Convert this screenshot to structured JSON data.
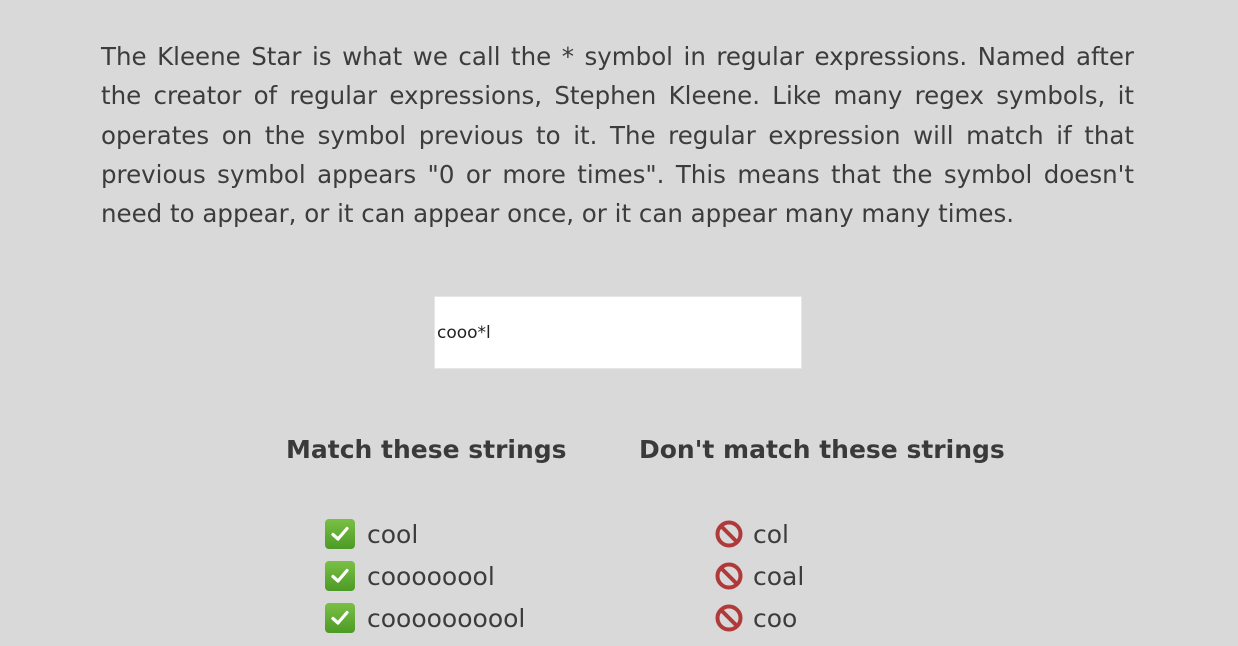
{
  "lesson": {
    "paragraph": "The Kleene Star is what we call the * symbol in regular expressions. Named after the creator of regular expressions, Stephen Kleene. Like many regex symbols, it operates on the symbol previous to it. The regular expression will match if that previous symbol appears \"0 or more times\". This means that the symbol doesn't need to appear, or it can appear once, or it can appear many many times."
  },
  "regex_input": {
    "value": "cooo*l"
  },
  "match": {
    "heading": "Match these strings",
    "icon": "check-icon",
    "color": "#5aa72f",
    "items": [
      "cool",
      "coooooool",
      "coooooooool"
    ]
  },
  "nomatch": {
    "heading": "Don't match these strings",
    "icon": "no-entry-icon",
    "color": "#b03a3a",
    "items": [
      "col",
      "coal",
      "coo"
    ]
  }
}
